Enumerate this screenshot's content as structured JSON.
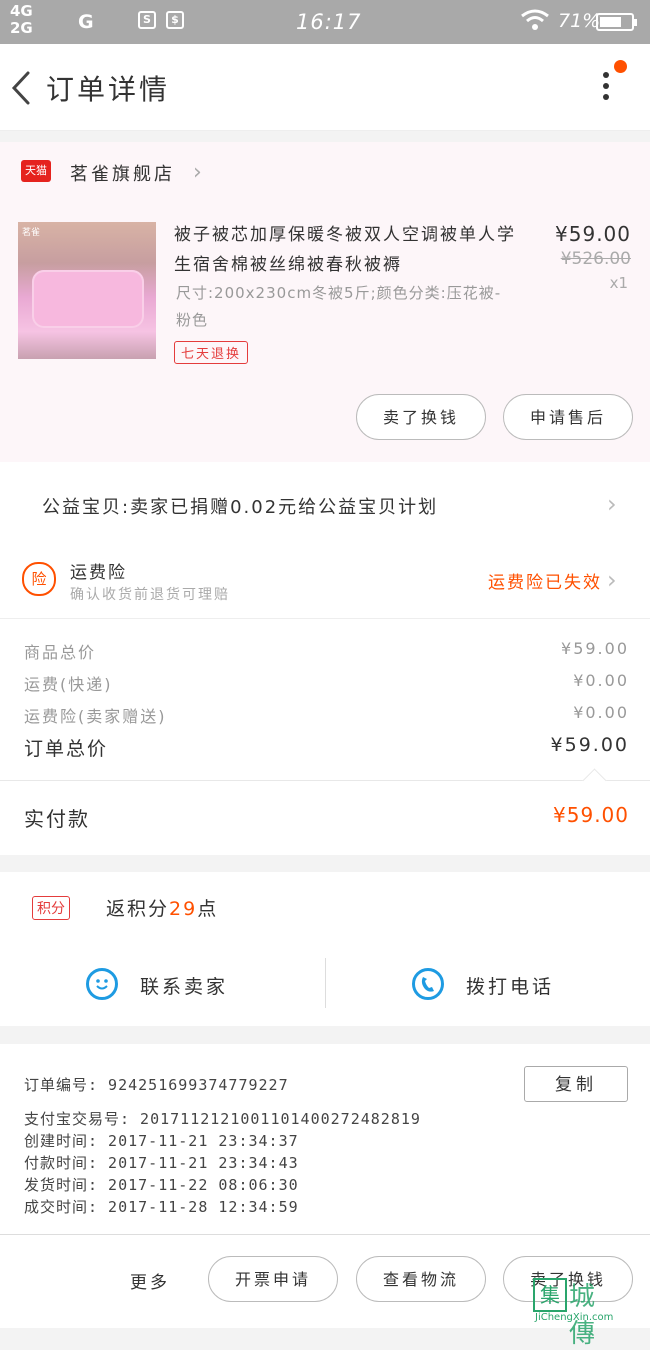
{
  "status_bar": {
    "signal_top": "4G",
    "signal_bottom": "2G",
    "signal_extra": "G",
    "time": "16:17",
    "battery_text": "71%",
    "battery_level": 0.71
  },
  "header": {
    "title": "订单详情"
  },
  "shop": {
    "platform_badge": "天猫",
    "name": "茗雀旗舰店",
    "thumb_brand": "茗雀",
    "product_title": "被子被芯加厚保暖冬被双人空调被单人学生宿舍棉被丝绵被春秋被褥",
    "spec": "尺寸:200x230cm冬被5斤;颜色分类:压花被-粉色",
    "return_tag": "七天退换",
    "price": "¥59.00",
    "original_price": "¥526.00",
    "quantity": "x1",
    "btn_sold_swap": "卖了换钱",
    "btn_after_sale": "申请售后"
  },
  "charity": {
    "text": "公益宝贝:卖家已捐赠0.02元给公益宝贝计划"
  },
  "insurance": {
    "badge": "险",
    "title": "运费险",
    "subtitle": "确认收货前退货可理赔",
    "status": "运费险已失效"
  },
  "totals": {
    "rows": [
      {
        "label": "商品总价",
        "value": "¥59.00"
      },
      {
        "label": "运费(快递)",
        "value": "¥0.00"
      },
      {
        "label": "运费险(卖家赠送)",
        "value": "¥0.00"
      }
    ],
    "order_total_label": "订单总价",
    "order_total_value": "¥59.00"
  },
  "payment": {
    "label": "实付款",
    "value": "¥59.00"
  },
  "points": {
    "badge": "积分",
    "prefix": "返积分",
    "count": "29",
    "suffix": "点"
  },
  "contact": {
    "seller_label": "联系卖家",
    "call_label": "拨打电话"
  },
  "order_info": {
    "order_no": "订单编号:  924251699374779227",
    "copy_label": "复制",
    "alipay_no": "支付宝交易号:  2017112121001101400272482819",
    "created": "创建时间:  2017-11-21  23:34:37",
    "paid": "付款时间:  2017-11-21  23:34:43",
    "shipped": "发货时间:  2017-11-22  08:06:30",
    "completed": "成交时间:  2017-11-28  12:34:59"
  },
  "bottom_bar": {
    "more_label": "更多",
    "btn_invoice": "开票申请",
    "btn_logistics": "查看物流",
    "btn_sold_swap": "卖了换钱"
  },
  "watermark": {
    "mark": "集",
    "word": "城傳",
    "url": "JiChengXin.com"
  }
}
